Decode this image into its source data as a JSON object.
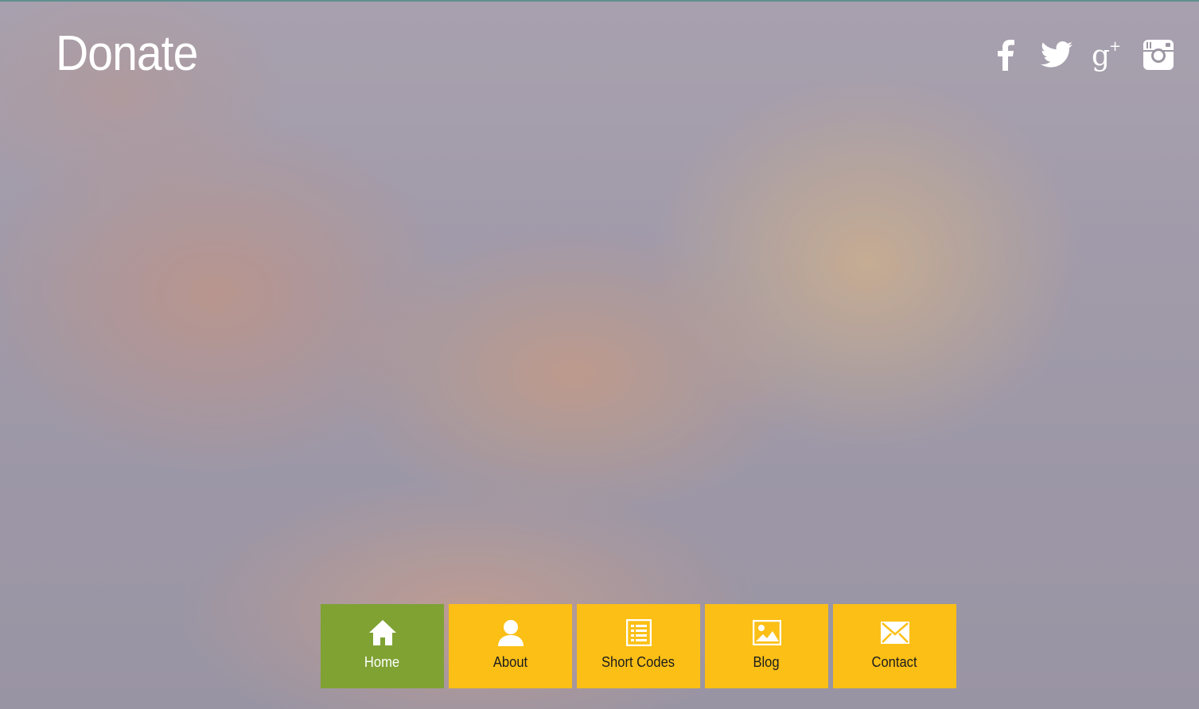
{
  "header": {
    "title": "Donate"
  },
  "social": [
    {
      "icon": "facebook-icon"
    },
    {
      "icon": "twitter-icon"
    },
    {
      "icon": "google-plus-icon"
    },
    {
      "icon": "instagram-icon"
    }
  ],
  "nav": {
    "items": [
      {
        "label": "Home",
        "icon": "home-icon",
        "active": true
      },
      {
        "label": "About",
        "icon": "user-icon",
        "active": false
      },
      {
        "label": "Short Codes",
        "icon": "list-icon",
        "active": false
      },
      {
        "label": "Blog",
        "icon": "picture-icon",
        "active": false
      },
      {
        "label": "Contact",
        "icon": "envelope-icon",
        "active": false
      }
    ]
  },
  "colors": {
    "nav_default": "#fbbf16",
    "nav_active": "#7fa233",
    "text_light": "#ffffff",
    "text_dark": "#1d1d1d"
  }
}
